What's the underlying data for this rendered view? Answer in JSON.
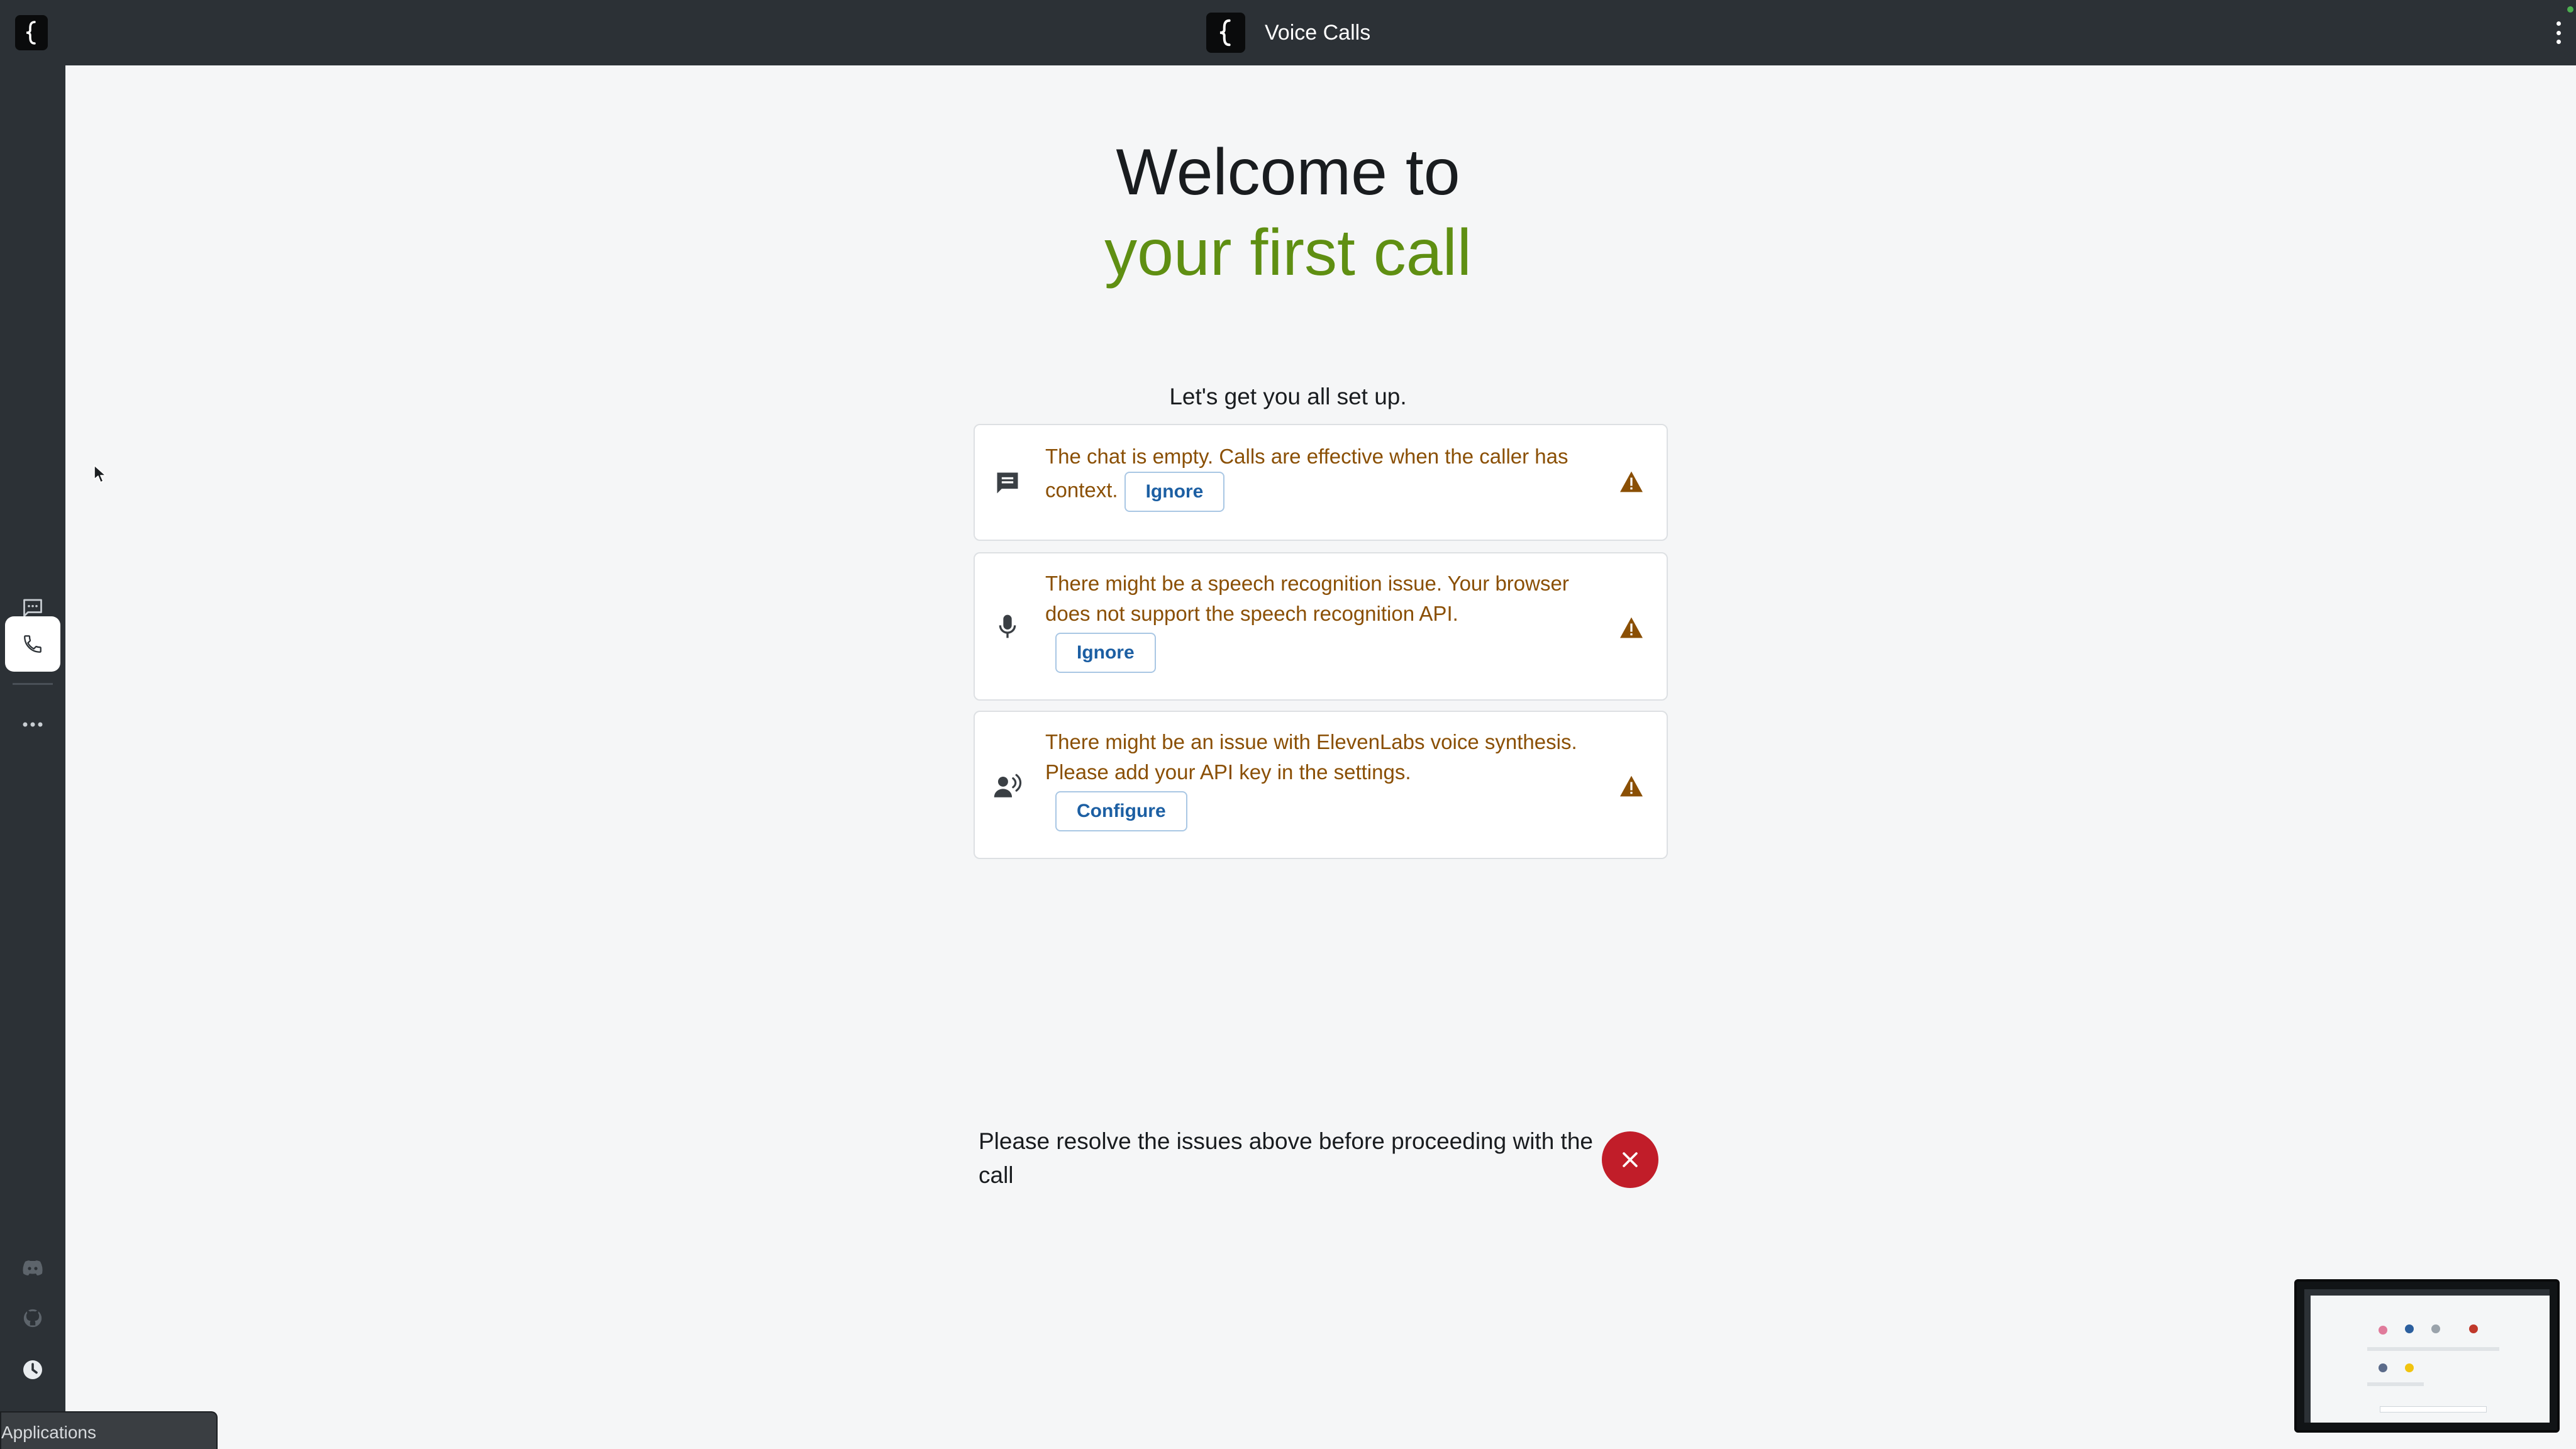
{
  "header": {
    "title": "Voice Calls",
    "menu_icon": "kebab-menu-icon",
    "status_color": "#4caf50"
  },
  "sidebar": {
    "items": [
      {
        "name": "chat",
        "icon": "chat-icon",
        "active": false
      },
      {
        "name": "call",
        "icon": "phone-icon",
        "active": true
      },
      {
        "name": "more",
        "icon": "more-horizontal-icon",
        "active": false
      }
    ],
    "bottom_icons": [
      "discord-icon",
      "github-icon",
      "update-icon"
    ]
  },
  "welcome": {
    "line1": "Welcome to",
    "line2": "your first call",
    "subtitle": "Let's get you all set up."
  },
  "checks": [
    {
      "icon": "chat-bubble-icon",
      "message": "The chat is empty. Calls are effective when the caller has context.",
      "action": "Ignore",
      "status_icon": "warning-icon"
    },
    {
      "icon": "microphone-icon",
      "message": "There might be a speech recognition issue. Your browser does not support the speech recognition API.",
      "action": "Ignore",
      "status_icon": "warning-icon"
    },
    {
      "icon": "voice-speaker-icon",
      "message": "There might be an issue with ElevenLabs voice synthesis. Please add your API key in the settings.",
      "action": "Configure",
      "status_icon": "warning-icon"
    }
  ],
  "footer": {
    "resolve_message": "Please resolve the issues above before proceeding with the call",
    "cancel_icon": "close-icon"
  },
  "taskbar": {
    "applications_label": "Applications"
  },
  "colors": {
    "accent_green": "#5f8f12",
    "warning_text": "#8a4f04",
    "warning_icon": "#8a4f04",
    "button_text": "#1c5fa3",
    "danger": "#c11d29",
    "bar_bg": "#2c3136"
  }
}
